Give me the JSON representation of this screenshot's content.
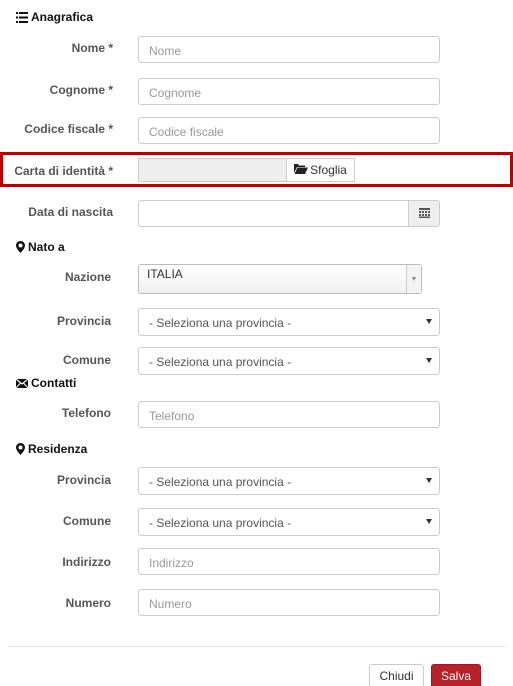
{
  "anagrafica": {
    "title": "Anagrafica",
    "nome": {
      "label": "Nome *",
      "placeholder": "Nome"
    },
    "cognome": {
      "label": "Cognome *",
      "placeholder": "Cognome"
    },
    "codice_fiscale": {
      "label": "Codice fiscale *",
      "placeholder": "Codice fiscale"
    },
    "carta_identita": {
      "label": "Carta di identità *",
      "browse_label": "Sfoglia"
    },
    "data_nascita": {
      "label": "Data di nascita"
    }
  },
  "nato_a": {
    "title": "Nato a",
    "nazione": {
      "label": "Nazione",
      "value": "ITALIA"
    },
    "provincia": {
      "label": "Provincia",
      "value": "- Seleziona una provincia -"
    },
    "comune": {
      "label": "Comune",
      "value": "- Seleziona una provincia -"
    }
  },
  "contatti": {
    "title": "Contatti",
    "telefono": {
      "label": "Telefono",
      "placeholder": "Telefono"
    }
  },
  "residenza": {
    "title": "Residenza",
    "provincia": {
      "label": "Provincia",
      "value": "- Seleziona una provincia -"
    },
    "comune": {
      "label": "Comune",
      "value": "- Seleziona una provincia -"
    },
    "indirizzo": {
      "label": "Indirizzo",
      "placeholder": "Indirizzo"
    },
    "numero": {
      "label": "Numero",
      "placeholder": "Numero"
    }
  },
  "footer": {
    "close_label": "Chiudi",
    "save_label": "Salva"
  },
  "colors": {
    "highlight": "#c00000",
    "save_button": "#b8202a"
  }
}
